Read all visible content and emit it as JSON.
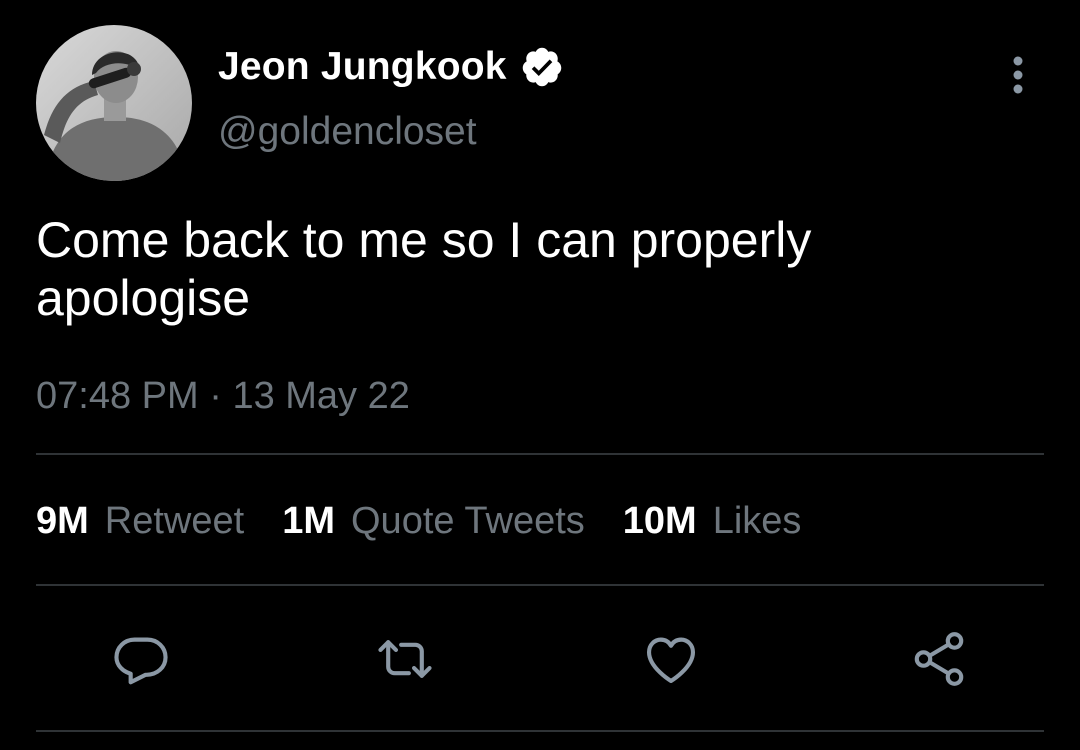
{
  "tweet": {
    "author": {
      "display_name": "Jeon Jungkook",
      "handle": "@goldencloset",
      "verified": true,
      "avatar_icon": "avatar-photo"
    },
    "text": "Come back to me so I can properly apologise",
    "time": "07:48 PM",
    "separator": "·",
    "date": "13 May 22"
  },
  "stats": [
    {
      "count": "9M",
      "label": "Retweet"
    },
    {
      "count": "1M",
      "label": "Quote Tweets"
    },
    {
      "count": "10M",
      "label": "Likes"
    }
  ],
  "actions": [
    {
      "icon": "reply-icon"
    },
    {
      "icon": "retweet-icon"
    },
    {
      "icon": "like-icon"
    },
    {
      "icon": "share-icon"
    }
  ],
  "colors": {
    "background": "#000000",
    "primary_text": "#ffffff",
    "secondary_text": "#6e767d",
    "divider": "#2f3336",
    "icon": "#8b98a5"
  }
}
